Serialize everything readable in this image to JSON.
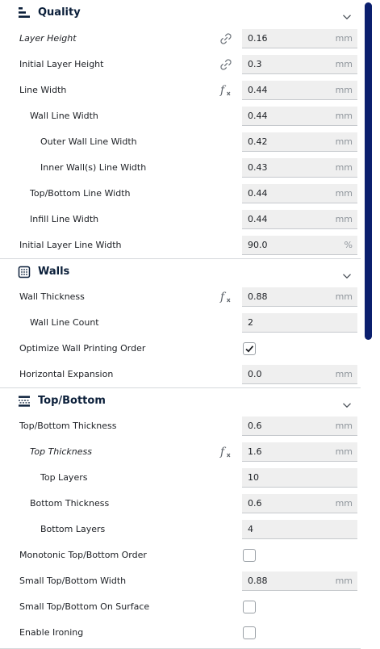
{
  "colors": {
    "accent": "#0b1f6e",
    "field_bg": "#efefef",
    "divider": "#d5d8dc"
  },
  "sections": [
    {
      "title": "Quality",
      "icon": "quality-icon",
      "rows": [
        {
          "label": "Layer Height",
          "italic": true,
          "indent": 0,
          "icon": "link-icon",
          "value": "0.16",
          "unit": "mm"
        },
        {
          "label": "Initial Layer Height",
          "indent": 0,
          "icon": "link-icon",
          "value": "0.3",
          "unit": "mm"
        },
        {
          "label": "Line Width",
          "indent": 0,
          "icon": "function-icon",
          "value": "0.44",
          "unit": "mm"
        },
        {
          "label": "Wall Line Width",
          "indent": 1,
          "value": "0.44",
          "unit": "mm"
        },
        {
          "label": "Outer Wall Line Width",
          "indent": 2,
          "value": "0.42",
          "unit": "mm"
        },
        {
          "label": "Inner Wall(s) Line Width",
          "indent": 2,
          "value": "0.43",
          "unit": "mm"
        },
        {
          "label": "Top/Bottom Line Width",
          "indent": 1,
          "value": "0.44",
          "unit": "mm"
        },
        {
          "label": "Infill Line Width",
          "indent": 1,
          "value": "0.44",
          "unit": "mm"
        },
        {
          "label": "Initial Layer Line Width",
          "indent": 0,
          "value": "90.0",
          "unit": "%"
        }
      ]
    },
    {
      "title": "Walls",
      "icon": "walls-icon",
      "rows": [
        {
          "label": "Wall Thickness",
          "indent": 0,
          "icon": "function-icon",
          "value": "0.88",
          "unit": "mm"
        },
        {
          "label": "Wall Line Count",
          "indent": 1,
          "value": "2",
          "unit": ""
        },
        {
          "label": "Optimize Wall Printing Order",
          "indent": 0,
          "checkbox": true,
          "checked": true
        },
        {
          "label": "Horizontal Expansion",
          "indent": 0,
          "value": "0.0",
          "unit": "mm"
        }
      ]
    },
    {
      "title": "Top/Bottom",
      "icon": "top-bottom-icon",
      "rows": [
        {
          "label": "Top/Bottom Thickness",
          "indent": 0,
          "value": "0.6",
          "unit": "mm"
        },
        {
          "label": "Top Thickness",
          "italic": true,
          "indent": 1,
          "icon": "function-icon",
          "value": "1.6",
          "unit": "mm"
        },
        {
          "label": "Top Layers",
          "indent": 2,
          "value": "10",
          "unit": ""
        },
        {
          "label": "Bottom Thickness",
          "indent": 1,
          "value": "0.6",
          "unit": "mm"
        },
        {
          "label": "Bottom Layers",
          "indent": 2,
          "value": "4",
          "unit": ""
        },
        {
          "label": "Monotonic Top/Bottom Order",
          "indent": 0,
          "checkbox": true,
          "checked": false
        },
        {
          "label": "Small Top/Bottom Width",
          "indent": 0,
          "value": "0.88",
          "unit": "mm"
        },
        {
          "label": "Small Top/Bottom On Surface",
          "indent": 0,
          "checkbox": true,
          "checked": false
        },
        {
          "label": "Enable Ironing",
          "indent": 0,
          "checkbox": true,
          "checked": false
        }
      ]
    }
  ]
}
